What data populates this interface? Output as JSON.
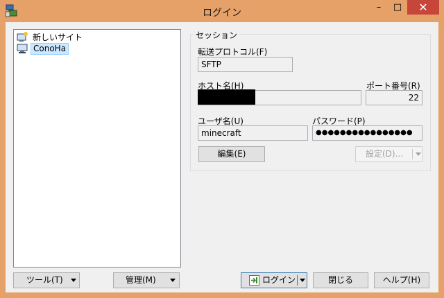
{
  "window": {
    "title": "ログイン",
    "minimize": "–",
    "maximize": "□",
    "close": "✕"
  },
  "tree": {
    "items": [
      {
        "label": "新しいサイト",
        "icon": "new-site-icon"
      },
      {
        "label": "ConoHa",
        "icon": "computer-icon",
        "selected": true
      }
    ]
  },
  "session": {
    "legend": "セッション",
    "protocol_label": "転送プロトコル(F)",
    "protocol_value": "SFTP",
    "host_label": "ホスト名(H)",
    "host_value": "",
    "port_label": "ポート番号(R)",
    "port_value": "22",
    "user_label": "ユーザ名(U)",
    "user_value": "minecraft",
    "password_label": "パスワード(P)",
    "password_value": "●●●●●●●●●●●●●●●●",
    "edit_label": "編集(E)",
    "settings_label": "設定(D)..."
  },
  "bottom": {
    "tools_label": "ツール(T)",
    "manage_label": "管理(M)",
    "login_label": "ログイン",
    "close_label": "閉じる",
    "help_label": "ヘルプ(H)"
  }
}
